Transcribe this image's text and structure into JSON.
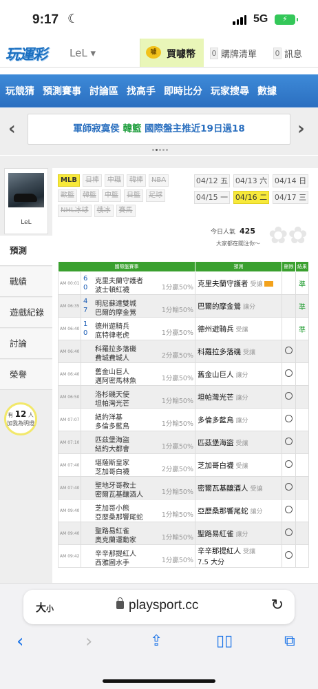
{
  "status_bar": {
    "time": "9:17",
    "network": "5G"
  },
  "site": {
    "logo": "玩運彩",
    "user": "LeL ▾",
    "buy_coins": "買噱幣",
    "cart_count": "0",
    "cart_label": "購牌清單",
    "msg_count": "0",
    "msg_label": "訊息"
  },
  "nav": {
    "items": [
      "玩競猜",
      "預測賽事",
      "討論區",
      "找高手",
      "即時比分",
      "玩家搜尋",
      "數據"
    ]
  },
  "banner": {
    "pre": "軍師寂寞侯 ",
    "hl": "韓籃",
    "post": " 國際盤主推近19日過18"
  },
  "sidebar": {
    "username": "LeL",
    "items": [
      "預測",
      "戰績",
      "遊戲紀錄",
      "討論",
      "榮譽"
    ],
    "helpers_pre": "有",
    "helpers_count": "12",
    "helpers_unit": "人",
    "helpers_text": "加我為明燈"
  },
  "leagues": [
    "MLB",
    "日棒",
    "中職",
    "韓棒",
    "NBA",
    "歐籃",
    "韓籃",
    "中籃",
    "日籃",
    "足球",
    "NHL冰球",
    "俄冰",
    "賽馬"
  ],
  "dates": [
    "04/12 五",
    "04/13 六",
    "04/14 日",
    "04/15 一",
    "04/16 二",
    "04/17 三"
  ],
  "popularity": {
    "label": "今日人氣",
    "value": "425",
    "note": "大家都在關注你～"
  },
  "table": {
    "headers": [
      "國際盤賽事",
      "預測",
      "刪除",
      "結果"
    ],
    "rows": [
      {
        "time": "AM 00:01",
        "s1": "6",
        "t1": "克里夫蘭守護者",
        "s2": "0",
        "t2": "波士頓紅襪",
        "odds": "1分贏50%",
        "pick": "克里夫蘭守護者",
        "pick_side": "受讓",
        "result": "準"
      },
      {
        "time": "AM 06:35",
        "s1": "4",
        "t1": "明尼蘇達雙城",
        "s2": "7",
        "t2": "巴爾的摩金鶯",
        "odds": "1分輸50%",
        "pick": "巴爾的摩金鶯",
        "pick_side": "讓分",
        "result": "準"
      },
      {
        "time": "AM 06:40",
        "s1": "1",
        "t1": "德州遊騎兵",
        "s2": "0",
        "t2": "底特律老虎",
        "odds": "1分贏50%",
        "pick": "德州遊騎兵",
        "pick_side": "受讓",
        "result": "準"
      },
      {
        "time": "AM 06:40",
        "s1": "",
        "t1": "科羅拉多落磯",
        "s2": "",
        "t2": "費城費城人",
        "odds": "2分贏50%",
        "pick": "科羅拉多落磯",
        "pick_side": "受讓",
        "result": ""
      },
      {
        "time": "AM 06:40",
        "s1": "",
        "t1": "舊金山巨人",
        "s2": "",
        "t2": "邁阿密馬林魚",
        "odds": "1分贏50%",
        "pick": "舊金山巨人",
        "pick_side": "讓分",
        "result": ""
      },
      {
        "time": "AM 06:50",
        "s1": "",
        "t1": "洛杉磯天使",
        "s2": "",
        "t2": "坦帕灣光芒",
        "odds": "1分輸50%",
        "pick": "坦帕灣光芒",
        "pick_side": "讓分",
        "result": ""
      },
      {
        "time": "AM 07:07",
        "s1": "",
        "t1": "紐約洋基",
        "s2": "",
        "t2": "多倫多藍鳥",
        "odds": "1分輸50%",
        "pick": "多倫多藍鳥",
        "pick_side": "讓分",
        "result": ""
      },
      {
        "time": "AM 07:10",
        "s1": "",
        "t1": "匹茲堡海盜",
        "s2": "",
        "t2": "紐約大都會",
        "odds": "1分贏50%",
        "pick": "匹茲堡海盜",
        "pick_side": "受讓",
        "result": ""
      },
      {
        "time": "AM 07:40",
        "s1": "",
        "t1": "堪薩斯皇家",
        "s2": "",
        "t2": "芝加哥白襪",
        "odds": "2分贏50%",
        "pick": "芝加哥白襪",
        "pick_side": "受讓",
        "result": ""
      },
      {
        "time": "AM 07:40",
        "s1": "",
        "t1": "聖地牙哥教士",
        "s2": "",
        "t2": "密爾瓦基釀酒人",
        "odds": "1分輸50%",
        "pick": "密爾瓦基釀酒人",
        "pick_side": "受讓",
        "result": ""
      },
      {
        "time": "AM 09:40",
        "s1": "",
        "t1": "芝加哥小熊",
        "s2": "",
        "t2": "亞歷桑那響尾蛇",
        "odds": "1分輸50%",
        "pick": "亞歷桑那響尾蛇",
        "pick_side": "讓分",
        "result": ""
      },
      {
        "time": "AM 09:40",
        "s1": "",
        "t1": "聖路易紅雀",
        "s2": "",
        "t2": "奧克蘭運動家",
        "odds": "1分輸50%",
        "pick": "聖路易紅雀",
        "pick_side": "讓分",
        "result": ""
      },
      {
        "time": "AM 09:42",
        "s1": "",
        "t1": "辛辛那提紅人",
        "s2": "",
        "t2": "西雅圖水手",
        "odds": "1分贏50%",
        "pick": "辛辛那提紅人",
        "pick_side": "受讓",
        "sub": "7.5 大分",
        "result": ""
      }
    ]
  },
  "browser": {
    "aa_big": "大",
    "aa_small": "小",
    "url": "playsport.cc"
  }
}
